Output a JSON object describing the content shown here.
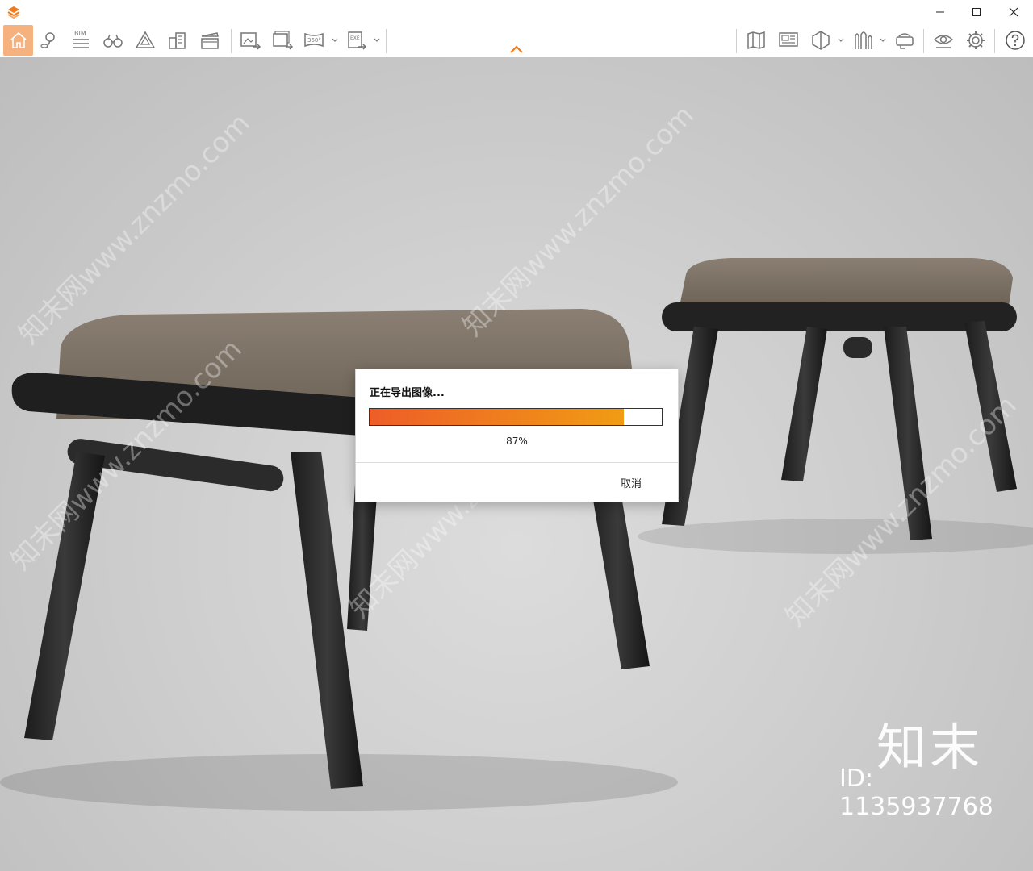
{
  "window": {
    "minimize_icon": "minimize-icon",
    "maximize_icon": "maximize-icon",
    "close_icon": "close-icon"
  },
  "toolbar": {
    "accent": "#f6b27e",
    "bim_label": "BIM",
    "pano_label": "360°",
    "exe_label": "EXE",
    "left_icons": [
      "home-icon",
      "location-pin-icon",
      "bim-list-icon",
      "binoculars-icon",
      "terrain-icon",
      "buildings-icon",
      "clapboard-icon",
      "export-image-icon",
      "export-batch-icon",
      "export-panorama-icon",
      "export-exe-icon"
    ],
    "right_icons": [
      "map-icon",
      "screen-icon",
      "cube-icon",
      "vegetation-icon",
      "vr-headset-icon",
      "eye-icon",
      "gear-icon",
      "help-icon"
    ]
  },
  "viewport": {
    "watermark": "知末网www.znzmo.com",
    "brand": "知末",
    "id_label": "ID: 1135937768"
  },
  "dialog": {
    "title": "正在导出图像...",
    "progress": 0.87,
    "progress_text": "87%",
    "cancel_label": "取消",
    "bar_start_color": "#ee5d28",
    "bar_end_color": "#f09c14"
  }
}
